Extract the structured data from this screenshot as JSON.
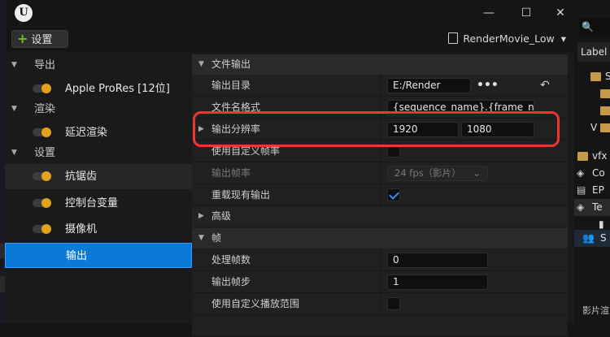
{
  "window": {
    "app_logo": "U",
    "minimize_glyph": "—",
    "maximize_glyph": "☐",
    "close_glyph": "✕"
  },
  "toolbar": {
    "settings_label": "设置",
    "preset_label": "RenderMovie_Low",
    "preset_caret": "▾"
  },
  "left_panel": {
    "groups": [
      {
        "label": "导出",
        "items": [
          {
            "label": "Apple ProRes [12位]"
          }
        ]
      },
      {
        "label": "渲染",
        "items": [
          {
            "label": "延迟渲染"
          }
        ]
      },
      {
        "label": "设置",
        "items": [
          {
            "label": "抗锯齿",
            "state": "hovered"
          },
          {
            "label": "控制台变量"
          },
          {
            "label": "摄像机"
          },
          {
            "label": "输出",
            "state": "selected"
          }
        ]
      }
    ]
  },
  "sections": {
    "file_output": {
      "title": "文件输出"
    },
    "advanced": {
      "title": "高级"
    },
    "frames": {
      "title": "帧"
    }
  },
  "properties": {
    "output_directory": {
      "label": "输出目录",
      "value": "E:/Render",
      "more": "•••",
      "reset": "↶"
    },
    "file_name_format": {
      "label": "文件名格式",
      "value": "{sequence_name}.{frame_nu"
    },
    "output_resolution": {
      "label": "输出分辨率",
      "width": "1920",
      "height": "1080"
    },
    "use_custom_frame_rate": {
      "label": "使用自定义帧率",
      "checked": false
    },
    "output_frame_rate": {
      "label": "输出帧率",
      "value": "24 fps（影片）",
      "caret": "⌄",
      "enabled": false
    },
    "overwrite_existing": {
      "label": "重载现有输出",
      "checked": true
    },
    "handle_frame_count": {
      "label": "处理帧数",
      "value": "0"
    },
    "output_frame_step": {
      "label": "输出帧步",
      "value": "1"
    },
    "use_custom_playback_range": {
      "label": "使用自定义播放范围",
      "checked": false
    }
  },
  "outliner": {
    "search_icon": "search-icon",
    "search_glyph": "🔍",
    "column_header": "Label",
    "rows": [
      {
        "icon": "folder-icon",
        "text": "S"
      },
      {
        "icon": "folder-icon",
        "text": ""
      },
      {
        "icon": "folder-icon",
        "text": ""
      },
      {
        "icon": "folder-icon",
        "text": "V"
      },
      {
        "icon": "folder-icon",
        "text": "vfx"
      },
      {
        "icon": "mesh-icon",
        "text": "Co"
      },
      {
        "icon": "clapper-icon",
        "text": "EP"
      },
      {
        "icon": "mesh-icon",
        "text": "Te"
      },
      {
        "icon": "person-icon",
        "text": ""
      },
      {
        "icon": "person-icon",
        "text": "S"
      }
    ],
    "footer": "影片渲"
  },
  "colors": {
    "accent": "#0a7ad6",
    "toggle": "#e3a21a",
    "highlight": "#e8392e",
    "add_plus": "#6abf2a"
  }
}
